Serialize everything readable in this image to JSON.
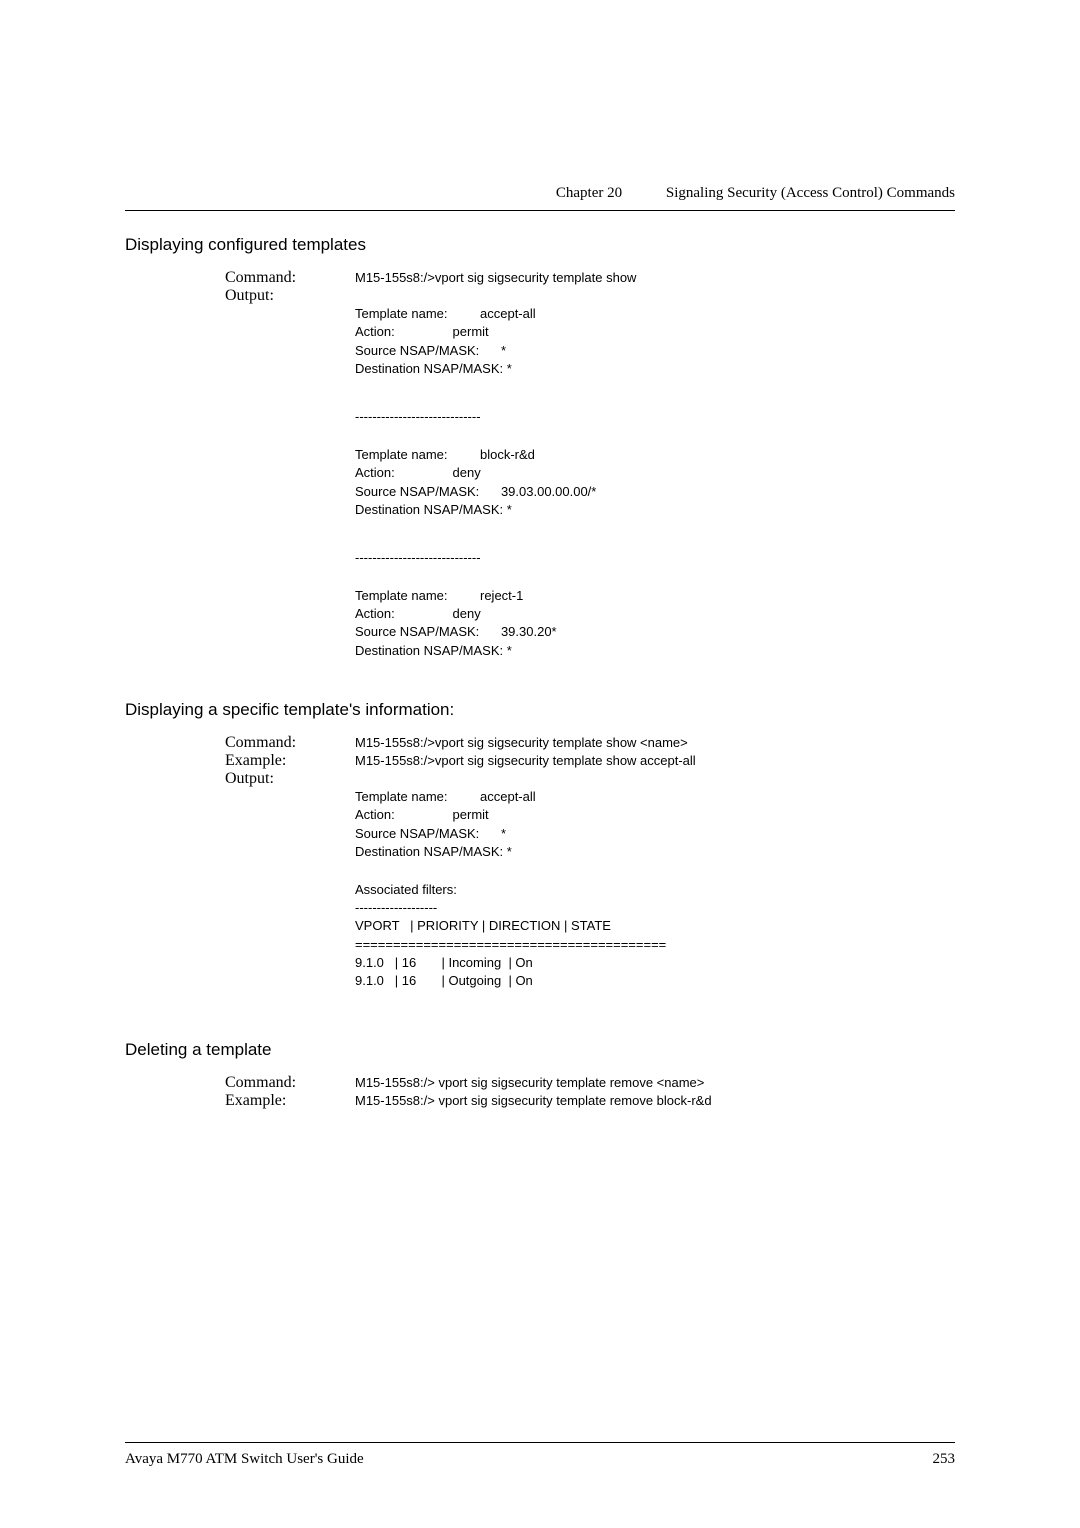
{
  "header": {
    "chapter": "Chapter 20",
    "title": "Signaling Security (Access Control) Commands"
  },
  "sections": {
    "s1": {
      "heading": "Displaying configured templates",
      "command_label": "Command:",
      "command_value": "M15-155s8:/>vport sig sigsecurity template show",
      "output_label": "Output:",
      "block1": "Template name:         accept-all\nAction:                permit\nSource NSAP/MASK:      *\nDestination NSAP/MASK: *",
      "sep1": "-----------------------------",
      "block2": "Template name:         block-r&d\nAction:                deny\nSource NSAP/MASK:      39.03.00.00.00/*\nDestination NSAP/MASK: *",
      "sep2": "-----------------------------",
      "block3": "Template name:         reject-1\nAction:                deny\nSource NSAP/MASK:      39.30.20*\nDestination NSAP/MASK: *"
    },
    "s2": {
      "heading": "Displaying a specific template's information:",
      "command_label": "Command:",
      "command_value": "M15-155s8:/>vport sig sigsecurity template show <name>",
      "example_label": "Example:",
      "example_value": "M15-155s8:/>vport sig sigsecurity template show accept-all",
      "output_label": "Output:",
      "block1": "Template name:         accept-all\nAction:                permit\nSource NSAP/MASK:      *\nDestination NSAP/MASK: *",
      "assoc": "Associated filters:",
      "dash": "-------------------",
      "tableheader": "VPORT   | PRIORITY | DIRECTION | STATE",
      "eqline": "=========================================",
      "tablerows": "9.1.0   | 16       | Incoming  | On\n9.1.0   | 16       | Outgoing  | On"
    },
    "s3": {
      "heading": "Deleting a template",
      "command_label": "Command:",
      "command_value": "M15-155s8:/> vport sig sigsecurity template remove <name>",
      "example_label": "Example:",
      "example_value": "M15-155s8:/> vport sig sigsecurity template remove block-r&d"
    }
  },
  "footer": {
    "left": "Avaya M770 ATM Switch User's Guide",
    "right": "253"
  }
}
